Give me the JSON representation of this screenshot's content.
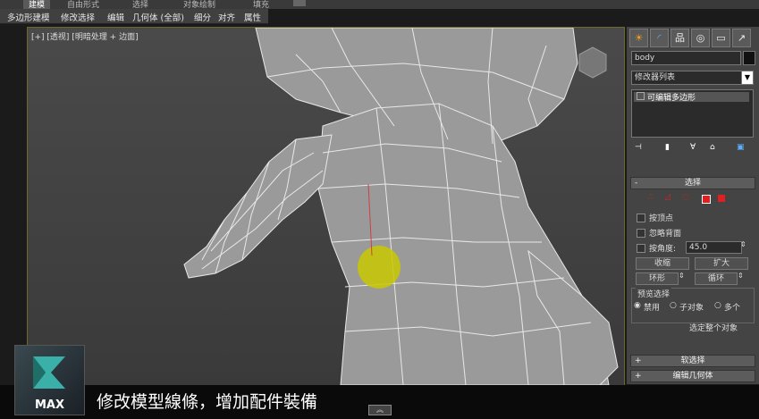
{
  "ribbon": {
    "tabs": [
      "建模",
      "自由形式",
      "选择",
      "对象绘制",
      "填充"
    ]
  },
  "menu": {
    "items": [
      "多边形建模",
      "修改选择",
      "编辑",
      "几何体 (全部)",
      "细分",
      "对齐",
      "属性"
    ]
  },
  "viewport": {
    "label": "[+] [透视] [明暗处理 + 边面]"
  },
  "panel": {
    "tab_icons": [
      "☀",
      "◜",
      "品",
      "◎",
      "▭",
      "↗"
    ],
    "object_name": "body",
    "modifier_list": "修改器列表",
    "modifier_stack_item": "可编辑多边形",
    "selection_rollout": {
      "title": "选择",
      "checkboxes": [
        "按顶点",
        "忽略背面",
        "按角度:"
      ],
      "angle_value": "45.0",
      "buttons": [
        "收缩",
        "扩大",
        "环形",
        "循环"
      ],
      "preview_title": "预览选择",
      "preview_options": [
        "禁用",
        "子对象",
        "多个"
      ],
      "status": "选定整个对象"
    },
    "soft_selection_title": "软选择",
    "edit_geometry_title": "编辑几何体",
    "plus_minus": [
      "-",
      "+"
    ]
  },
  "caption": {
    "text": "修改模型線條，增加配件裝備",
    "logo_text": "MAX"
  },
  "colors": {
    "highlight_sphere": "#c8c800",
    "viewport_border": "#8a8a2a",
    "selection_red": "#e02020"
  }
}
